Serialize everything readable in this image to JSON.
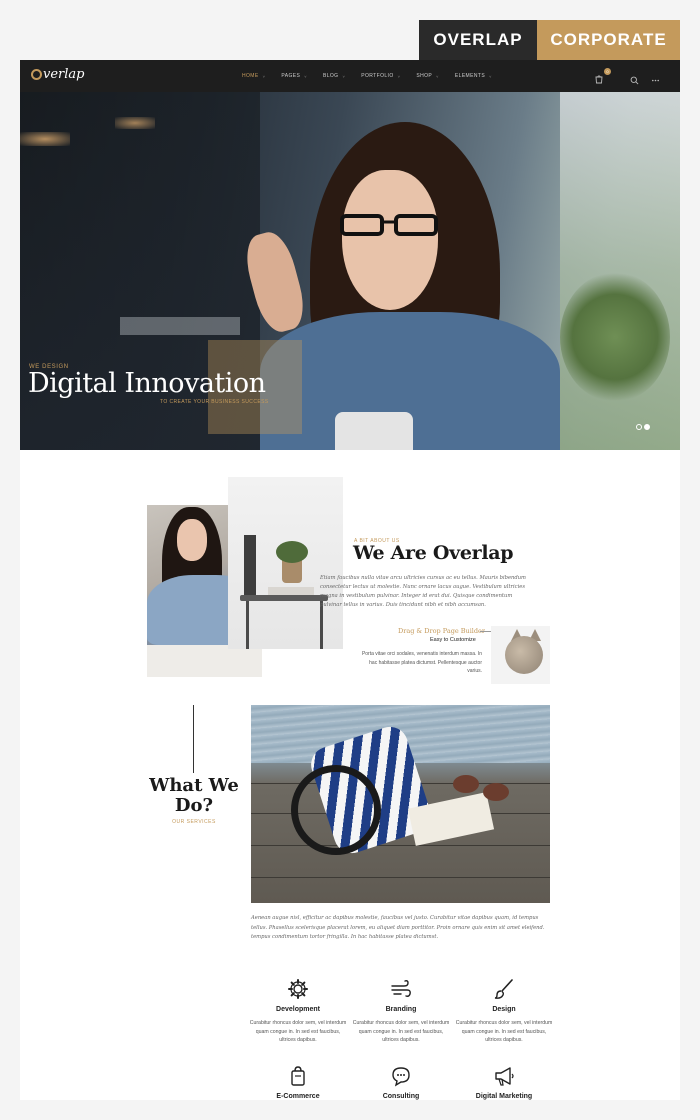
{
  "badge": {
    "left": "OVERLAP",
    "right": "CORPORATE"
  },
  "nav": {
    "logo": "verlap",
    "items": [
      {
        "label": "HOME",
        "active": true
      },
      {
        "label": "PAGES"
      },
      {
        "label": "BLOG"
      },
      {
        "label": "PORTFOLIO"
      },
      {
        "label": "SHOP"
      },
      {
        "label": "ELEMENTS"
      }
    ],
    "cart_count": "0",
    "icons": [
      "cart-icon",
      "search-icon",
      "more-icon"
    ]
  },
  "hero": {
    "kicker": "WE DESIGN",
    "title": "Digital Innovation",
    "subtitle": "TO CREATE YOUR BUSINESS SUCCESS",
    "slide_count": 2,
    "active_slide": 2
  },
  "about": {
    "kicker": "A BIT ABOUT US",
    "title": "We Are Overlap",
    "body": "Etiam faucibus nulla vitae arcu ultricies cursus ac eu tellus. Mauris bibendum consectetur lectus ut molestie. Nunc ornare lacus augue. Vestibulum ultricies magna in vestibulum pulvinar. Integer id erat dui. Quisque condimentum pulvinar tellus in varius. Duis tincidunt nibh et nibh accumsan.",
    "feature_title": "Drag & Drop Page Builder",
    "feature_subtitle": "Easy to Customize",
    "feature_body": "Porta vitae orci sodales, venenatis interdum massa. In hac habitasse platea dictumst. Pellentesque auctor varius."
  },
  "what_we_do": {
    "title_line1": "What We",
    "title_line2": "Do?",
    "subtitle": "OUR SERVICES",
    "body": "Aenean augue nisl, efficitur ac dapibus molestie, faucibus vel justo. Curabitur vitae dapibus quam, id tempus tellus. Phasellus scelerisque placerat lorem, eu aliquet diam porttitor. Proin ornare quis enim sit amet eleifend. tempus condimentum tortor fringilla. In hac habitasse platea dictumst."
  },
  "services": [
    {
      "name": "Development",
      "icon": "gear-icon",
      "desc": "Curabitur rhoncus dolor sem, vel interdum quam congue in. In sed est faucibus, ultrices dapibus."
    },
    {
      "name": "Branding",
      "icon": "wind-icon",
      "desc": "Curabitur rhoncus dolor sem, vel interdum quam congue in. In sed est faucibus, ultrices dapibus."
    },
    {
      "name": "Design",
      "icon": "brush-icon",
      "desc": "Curabitur rhoncus dolor sem, vel interdum quam congue in. In sed est faucibus, ultrices dapibus."
    },
    {
      "name": "E-Commerce",
      "icon": "shopping-bag-icon",
      "desc": ""
    },
    {
      "name": "Consulting",
      "icon": "chat-icon",
      "desc": ""
    },
    {
      "name": "Digital Marketing",
      "icon": "megaphone-icon",
      "desc": ""
    }
  ],
  "colors": {
    "accent": "#c49a5c",
    "dark": "#1e1e1e",
    "badge_dark": "#2a2a2a"
  }
}
